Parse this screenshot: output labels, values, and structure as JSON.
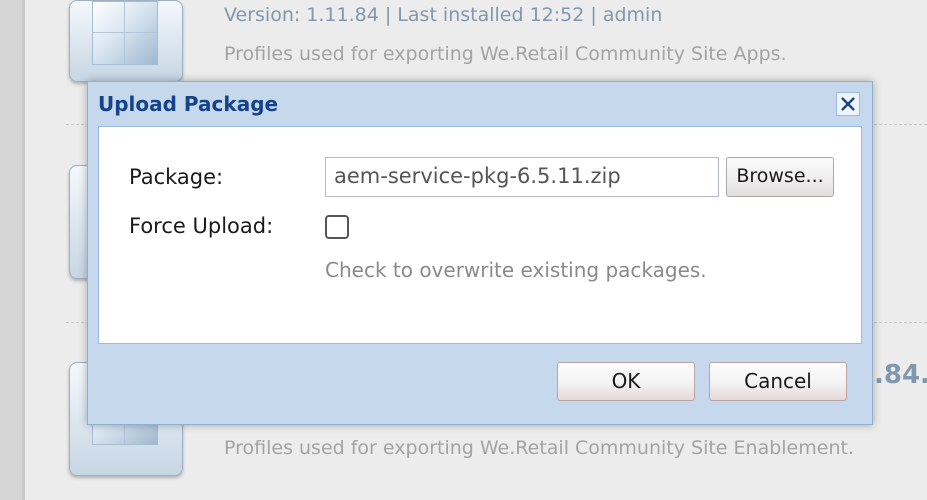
{
  "background": {
    "packages": [
      {
        "meta": "Version: 1.11.84 | Last installed 12:52 | admin",
        "description": "Profiles used for exporting We.Retail Community Site Apps."
      },
      {
        "version_peek": ".84.",
        "description": "Profiles used for exporting We.Retail Community Site Enablement."
      }
    ]
  },
  "dialog": {
    "title": "Upload Package",
    "close_icon": "close-icon",
    "package_label": "Package:",
    "package_value": "aem-service-pkg-6.5.11.zip",
    "browse_label": "Browse...",
    "force_upload_label": "Force Upload:",
    "force_upload_checked": false,
    "force_upload_hint": "Check to overwrite existing packages.",
    "ok_label": "OK",
    "cancel_label": "Cancel"
  },
  "colors": {
    "dialog_bg": "#c6d9ec",
    "title": "#15428b",
    "meta_text": "#7f98ae"
  }
}
